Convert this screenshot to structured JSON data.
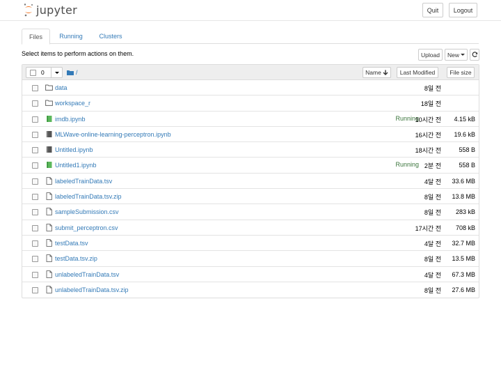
{
  "header": {
    "logo_text": "jupyter",
    "quit_label": "Quit",
    "logout_label": "Logout"
  },
  "tabs": [
    {
      "label": "Files",
      "active": true
    },
    {
      "label": "Running",
      "active": false
    },
    {
      "label": "Clusters",
      "active": false
    }
  ],
  "toolbar": {
    "hint": "Select items to perform actions on them.",
    "upload_label": "Upload",
    "new_label": "New",
    "refresh_icon": "refresh-icon"
  },
  "list_header": {
    "selected_count": "0",
    "breadcrumb": "/",
    "sort_name_label": "Name",
    "sort_modified_label": "Last Modified",
    "sort_size_label": "File size"
  },
  "colors": {
    "link": "#337ab7",
    "running": "#3c763d",
    "notebook_running": "#5cb85c",
    "notebook_idle": "#555555",
    "logo_orange": "#f37726"
  },
  "items": [
    {
      "type": "folder",
      "name": "data",
      "status": "",
      "modified": "8일 전",
      "size": ""
    },
    {
      "type": "folder",
      "name": "workspace_r",
      "status": "",
      "modified": "18일 전",
      "size": ""
    },
    {
      "type": "notebook-running",
      "name": "imdb.ipynb",
      "status": "Running",
      "modified": "10시간 전",
      "size": "4.15 kB"
    },
    {
      "type": "notebook",
      "name": "MLWave-online-learning-perceptron.ipynb",
      "status": "",
      "modified": "16시간 전",
      "size": "19.6 kB"
    },
    {
      "type": "notebook",
      "name": "Untitled.ipynb",
      "status": "",
      "modified": "18시간 전",
      "size": "558 B"
    },
    {
      "type": "notebook-running",
      "name": "Untitled1.ipynb",
      "status": "Running",
      "modified": "2분 전",
      "size": "558 B"
    },
    {
      "type": "file",
      "name": "labeledTrainData.tsv",
      "status": "",
      "modified": "4달 전",
      "size": "33.6 MB"
    },
    {
      "type": "file",
      "name": "labeledTrainData.tsv.zip",
      "status": "",
      "modified": "8일 전",
      "size": "13.8 MB"
    },
    {
      "type": "file",
      "name": "sampleSubmission.csv",
      "status": "",
      "modified": "8일 전",
      "size": "283 kB"
    },
    {
      "type": "file",
      "name": "submit_perceptron.csv",
      "status": "",
      "modified": "17시간 전",
      "size": "708 kB"
    },
    {
      "type": "file",
      "name": "testData.tsv",
      "status": "",
      "modified": "4달 전",
      "size": "32.7 MB"
    },
    {
      "type": "file",
      "name": "testData.tsv.zip",
      "status": "",
      "modified": "8일 전",
      "size": "13.5 MB"
    },
    {
      "type": "file",
      "name": "unlabeledTrainData.tsv",
      "status": "",
      "modified": "4달 전",
      "size": "67.3 MB"
    },
    {
      "type": "file",
      "name": "unlabeledTrainData.tsv.zip",
      "status": "",
      "modified": "8일 전",
      "size": "27.6 MB"
    }
  ]
}
